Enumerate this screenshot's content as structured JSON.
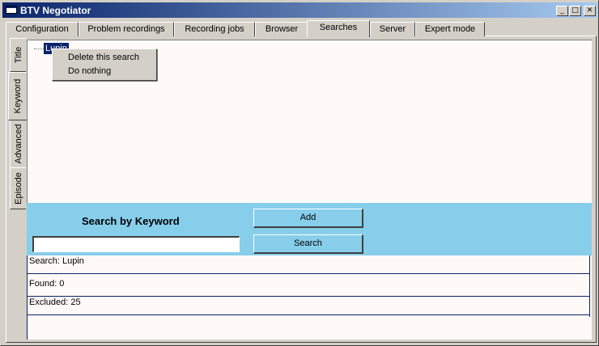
{
  "window": {
    "title": "BTV Negotiator",
    "controls": {
      "minimize": "_",
      "maximize": "□",
      "close": "✕"
    }
  },
  "tabs": [
    {
      "label": "Configuration",
      "active": false
    },
    {
      "label": "Problem recordings",
      "active": false
    },
    {
      "label": "Recording jobs",
      "active": false
    },
    {
      "label": "Browser",
      "active": false
    },
    {
      "label": "Searches",
      "active": true
    },
    {
      "label": "Server",
      "active": false
    },
    {
      "label": "Expert mode",
      "active": false
    }
  ],
  "side_tabs": [
    {
      "label": "Title",
      "active": false
    },
    {
      "label": "Keyword",
      "active": true
    },
    {
      "label": "Advanced",
      "active": false
    },
    {
      "label": "Episode",
      "active": false
    }
  ],
  "tree": {
    "node_label": "Lupin"
  },
  "context_menu": {
    "items": [
      "Delete this search",
      "Do nothing"
    ]
  },
  "search_panel": {
    "title": "Search by Keyword",
    "input_value": "",
    "add_label": "Add",
    "search_label": "Search"
  },
  "results": [
    "Search: Lupin",
    "Found: 0",
    "Excluded: 25"
  ],
  "colors": {
    "panel": "#87ceeb",
    "selection": "#0a246a",
    "titlebar": "#0a246a"
  }
}
